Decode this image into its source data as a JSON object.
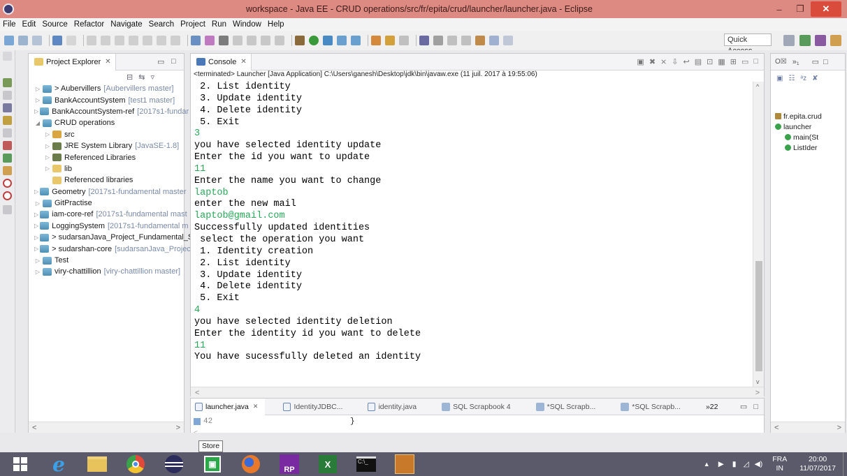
{
  "window": {
    "title": "workspace - Java EE - CRUD operations/src/fr/epita/crud/launcher/launcher.java - Eclipse"
  },
  "menu": [
    "File",
    "Edit",
    "Source",
    "Refactor",
    "Navigate",
    "Search",
    "Project",
    "Run",
    "Window",
    "Help"
  ],
  "toolbar": {
    "quick_access": "Quick Access"
  },
  "explorer": {
    "tab_label": "Project Explorer",
    "items": [
      {
        "name": "> Aubervillers",
        "repo": "[Aubervillers master]",
        "level": 0,
        "arrow": "▷",
        "icon": "proj"
      },
      {
        "name": "BankAccountSystem",
        "repo": "[test1 master]",
        "level": 0,
        "arrow": "▷",
        "icon": "proj"
      },
      {
        "name": "BankAccountSystem-ref",
        "repo": "[2017s1-fundar",
        "level": 0,
        "arrow": "▷",
        "icon": "proj"
      },
      {
        "name": "CRUD operations",
        "repo": "",
        "level": 0,
        "arrow": "◢",
        "icon": "proj"
      },
      {
        "name": "src",
        "repo": "",
        "level": 1,
        "arrow": "▷",
        "icon": "pkg"
      },
      {
        "name": "JRE System Library",
        "repo": "[JavaSE-1.8]",
        "level": 1,
        "arrow": "▷",
        "icon": "lib"
      },
      {
        "name": "Referenced Libraries",
        "repo": "",
        "level": 1,
        "arrow": "▷",
        "icon": "lib"
      },
      {
        "name": "lib",
        "repo": "",
        "level": 1,
        "arrow": "▷",
        "icon": "folder"
      },
      {
        "name": "Referenced libraries",
        "repo": "",
        "level": 1,
        "arrow": "",
        "icon": "folder"
      },
      {
        "name": "Geometry",
        "repo": "[2017s1-fundamental master",
        "level": 0,
        "arrow": "▷",
        "icon": "proj"
      },
      {
        "name": "GitPractise",
        "repo": "",
        "level": 0,
        "arrow": "▷",
        "icon": "proj"
      },
      {
        "name": "iam-core-ref",
        "repo": "[2017s1-fundamental mast",
        "level": 0,
        "arrow": "▷",
        "icon": "proj"
      },
      {
        "name": "LoggingSystem",
        "repo": "[2017s1-fundamental m",
        "level": 0,
        "arrow": "▷",
        "icon": "proj"
      },
      {
        "name": "> sudarsanJava_Project_Fundamental_S",
        "repo": "",
        "level": 0,
        "arrow": "▷",
        "icon": "proj"
      },
      {
        "name": "> sudarshan-core",
        "repo": "[sudarsanJava_Project",
        "level": 0,
        "arrow": "▷",
        "icon": "proj"
      },
      {
        "name": "Test",
        "repo": "",
        "level": 0,
        "arrow": "▷",
        "icon": "proj"
      },
      {
        "name": "viry-chattillion",
        "repo": "[viry-chattillion master]",
        "level": 0,
        "arrow": "▷",
        "icon": "proj"
      }
    ]
  },
  "console": {
    "tab_label": "Console",
    "header": "<terminated> Launcher [Java Application] C:\\Users\\ganesh\\Desktop\\jdk\\bin\\javaw.exe (11 juil. 2017 à 19:55:06)",
    "lines": [
      {
        "text": " 2. List identity",
        "input": false
      },
      {
        "text": " 3. Update identity",
        "input": false
      },
      {
        "text": " 4. Delete identity",
        "input": false
      },
      {
        "text": " 5. Exit",
        "input": false
      },
      {
        "text": "3",
        "input": true
      },
      {
        "text": "you have selected identity update",
        "input": false
      },
      {
        "text": "Enter the id you want to update",
        "input": false
      },
      {
        "text": "11",
        "input": true
      },
      {
        "text": "Enter the name you want to change",
        "input": false
      },
      {
        "text": "laptob",
        "input": true
      },
      {
        "text": "enter the new mail",
        "input": false
      },
      {
        "text": "laptob@gmail.com",
        "input": true
      },
      {
        "text": "Successfully updated identities",
        "input": false
      },
      {
        "text": " select the operation you want",
        "input": false
      },
      {
        "text": " 1. Identity creation",
        "input": false
      },
      {
        "text": " 2. List identity",
        "input": false
      },
      {
        "text": " 3. Update identity",
        "input": false
      },
      {
        "text": " 4. Delete identity",
        "input": false
      },
      {
        "text": " 5. Exit",
        "input": false
      },
      {
        "text": "4",
        "input": true
      },
      {
        "text": "you have selected identity deletion",
        "input": false
      },
      {
        "text": "Enter the identity id you want to delete",
        "input": false
      },
      {
        "text": "11",
        "input": true
      },
      {
        "text": "You have sucessfully deleted an identity",
        "input": false
      }
    ]
  },
  "editor": {
    "tabs": [
      {
        "label": "launcher.java",
        "active": true,
        "kind": "java"
      },
      {
        "label": "IdentityJDBC...",
        "active": false,
        "kind": "java"
      },
      {
        "label": "identity.java",
        "active": false,
        "kind": "java"
      },
      {
        "label": "SQL Scrapbook 4",
        "active": false,
        "kind": "sql"
      },
      {
        "label": "*SQL Scrapb...",
        "active": false,
        "kind": "sql"
      },
      {
        "label": "*SQL Scrapb...",
        "active": false,
        "kind": "sql"
      }
    ],
    "overflow": "»22",
    "line_number": "42",
    "line_code": "}"
  },
  "outline": {
    "items": [
      {
        "label": "fr.epita.crud",
        "level": 0
      },
      {
        "label": "launcher",
        "level": 0
      },
      {
        "label": "main(St",
        "level": 1
      },
      {
        "label": "ListIder",
        "level": 1
      }
    ]
  },
  "status": {
    "tooltip": "Store"
  },
  "taskbar": {
    "lang_top": "FRA",
    "lang_bottom": "IN",
    "time": "20:00",
    "date": "11/07/2017"
  },
  "colors": {
    "titlebar": "#dd8a82",
    "console_input": "#2aa85a",
    "taskbar": "#5a5a6a"
  }
}
